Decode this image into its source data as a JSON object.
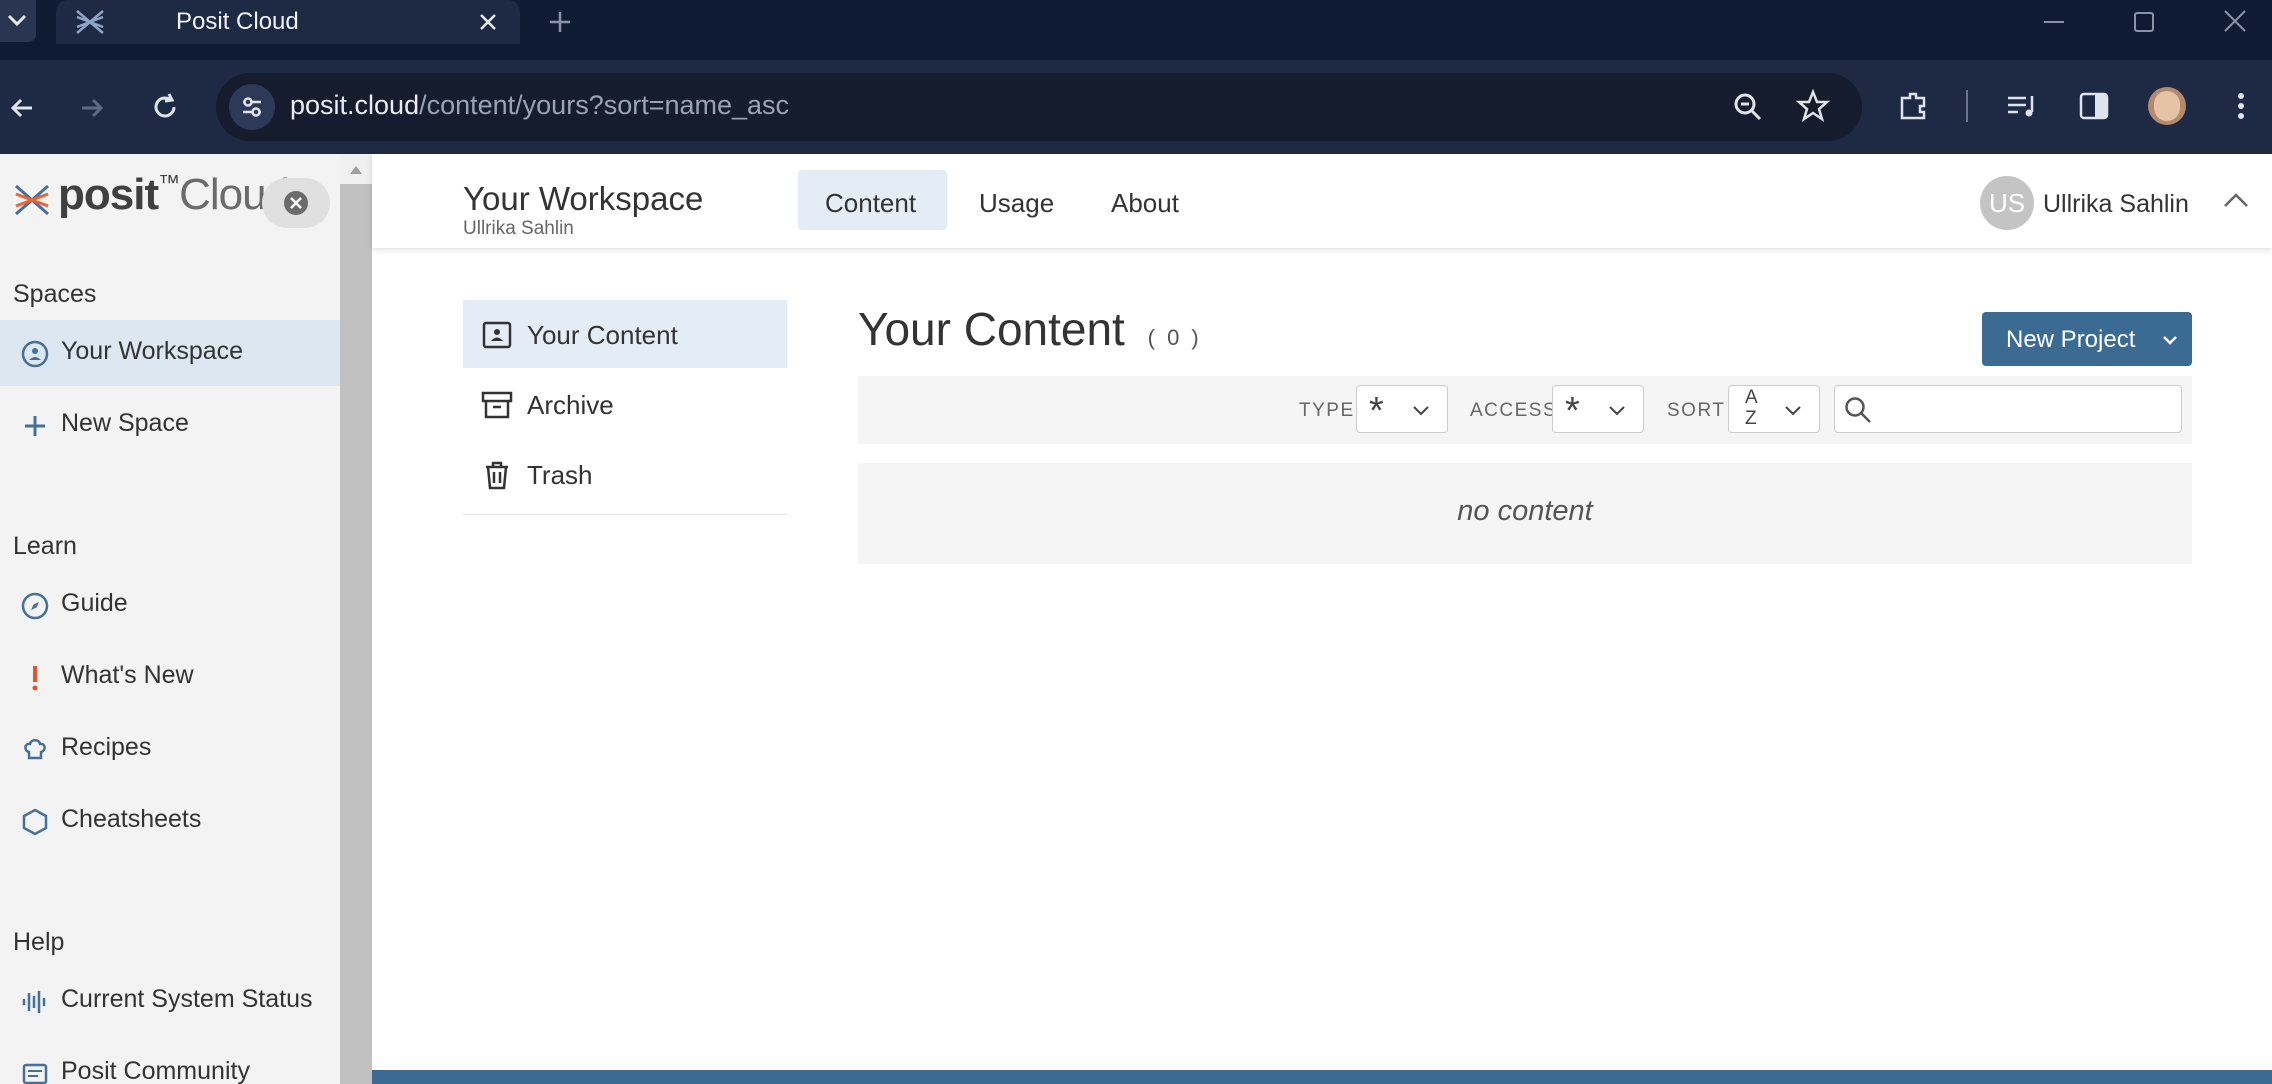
{
  "browser": {
    "tab_title": "Posit Cloud",
    "url_host": "posit.cloud",
    "url_path": "/content/yours?sort=name_asc"
  },
  "sidebar": {
    "logo_text_bold": "posit",
    "logo_text": "Cloud",
    "sections": {
      "spaces": "Spaces",
      "learn": "Learn",
      "help": "Help"
    },
    "spaces_items": [
      {
        "label": "Your Workspace",
        "icon": "user-circle-icon"
      },
      {
        "label": "New Space",
        "icon": "plus-icon"
      }
    ],
    "learn_items": [
      {
        "label": "Guide",
        "icon": "compass-icon"
      },
      {
        "label": "What's New",
        "icon": "exclamation-icon"
      },
      {
        "label": "Recipes",
        "icon": "chef-hat-icon"
      },
      {
        "label": "Cheatsheets",
        "icon": "hexagon-icon"
      }
    ],
    "help_items": [
      {
        "label": "Current System Status",
        "icon": "signal-icon"
      },
      {
        "label": "Posit Community",
        "icon": "community-icon"
      }
    ]
  },
  "header": {
    "title": "Your Workspace",
    "subtitle": "Ullrika Sahlin",
    "tabs": [
      "Content",
      "Usage",
      "About"
    ],
    "active_tab": "Content",
    "user_initials": "US",
    "user_name": "Ullrika Sahlin"
  },
  "subnav": [
    {
      "label": "Your Content",
      "icon": "id-card-icon"
    },
    {
      "label": "Archive",
      "icon": "archive-box-icon"
    },
    {
      "label": "Trash",
      "icon": "trash-icon"
    }
  ],
  "content": {
    "title": "Your Content",
    "count": "( 0 )",
    "new_project_label": "New Project",
    "empty_text": "no content"
  },
  "filters": {
    "type_label": "TYPE",
    "type_value": "*",
    "access_label": "ACCESS",
    "access_value": "*",
    "sort_label": "SORT",
    "sort_top": "A",
    "sort_bottom": "Z",
    "search_placeholder": ""
  },
  "colors": {
    "titlebar": "#0f1b33",
    "toolbar": "#1e2a44",
    "accent": "#3b6a93",
    "active_bg": "#e4edf6",
    "whats_new_icon": "#e0542f"
  }
}
